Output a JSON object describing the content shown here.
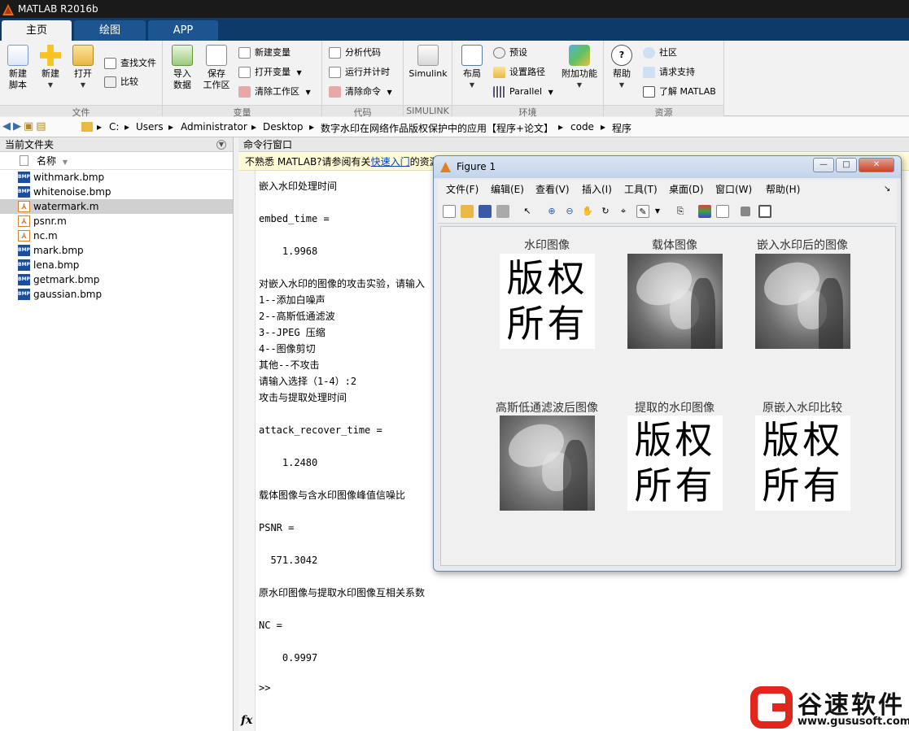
{
  "app": {
    "title": "MATLAB R2016b"
  },
  "tabs": [
    "主页",
    "绘图",
    "APP"
  ],
  "ribbon": {
    "file": {
      "label": "文件",
      "new_script": "新建\n脚本",
      "new": "新建",
      "open": "打开",
      "find_files": "查找文件",
      "compare": "比较"
    },
    "variable": {
      "label": "变量",
      "import": "导入\n数据",
      "save_ws": "保存\n工作区",
      "new_var": "新建变量",
      "open_var": "打开变量",
      "clear_ws": "清除工作区"
    },
    "code": {
      "label": "代码",
      "analyze": "分析代码",
      "run_time": "运行并计时",
      "clear_cmd": "清除命令"
    },
    "simulink": {
      "label": "SIMULINK",
      "simulink": "Simulink"
    },
    "env": {
      "label": "环境",
      "layout": "布局",
      "prefs": "预设",
      "set_path": "设置路径",
      "parallel": "Parallel",
      "addons": "附加功能"
    },
    "resources": {
      "label": "资源",
      "help": "帮助",
      "community": "社区",
      "support": "请求支持",
      "learn": "了解 MATLAB"
    }
  },
  "path": [
    "C:",
    "Users",
    "Administrator",
    "Desktop",
    "数字水印在网络作品版权保护中的应用【程序+论文】",
    "code",
    "程序"
  ],
  "current_folder": {
    "title": "当前文件夹",
    "column": "名称",
    "files": [
      {
        "name": "withmark.bmp",
        "type": "bmp"
      },
      {
        "name": "whitenoise.bmp",
        "type": "bmp"
      },
      {
        "name": "watermark.m",
        "type": "m"
      },
      {
        "name": "psnr.m",
        "type": "m"
      },
      {
        "name": "nc.m",
        "type": "m"
      },
      {
        "name": "mark.bmp",
        "type": "bmp"
      },
      {
        "name": "lena.bmp",
        "type": "bmp"
      },
      {
        "name": "getmark.bmp",
        "type": "bmp"
      },
      {
        "name": "gaussian.bmp",
        "type": "bmp"
      }
    ],
    "selected": "watermark.m"
  },
  "command_window": {
    "title": "命令行窗口",
    "notice_prefix": "不熟悉 MATLAB?请参阅有关",
    "notice_link": "快速入门",
    "notice_suffix": "的资源",
    "output": "嵌入水印处理时间\n\nembed_time =\n\n    1.9968\n\n对嵌入水印的图像的攻击实验，请输入\n1--添加白噪声\n2--高斯低通滤波\n3--JPEG 压缩\n4--图像剪切\n其他--不攻击\n请输入选择（1-4）:2\n攻击与提取处理时间\n\nattack_recover_time =\n\n    1.2480\n\n载体图像与含水印图像峰值信噪比\n\nPSNR =\n\n  571.3042\n\n原水印图像与提取水印图像互相关系数\n\nNC =\n\n    0.9997",
    "prompt": ">>"
  },
  "figure": {
    "title": "Figure 1",
    "menu": [
      "文件(F)",
      "编辑(E)",
      "查看(V)",
      "插入(I)",
      "工具(T)",
      "桌面(D)",
      "窗口(W)",
      "帮助(H)"
    ],
    "subplots": [
      {
        "title": "水印图像",
        "kind": "watermark"
      },
      {
        "title": "载体图像",
        "kind": "photo"
      },
      {
        "title": "嵌入水印后的图像",
        "kind": "noisy"
      },
      {
        "title": "高斯低通滤波后图像",
        "kind": "blur"
      },
      {
        "title": "提取的水印图像",
        "kind": "watermark"
      },
      {
        "title": "原嵌入水印比较",
        "kind": "watermark"
      }
    ],
    "watermark_text": "版权\n所有"
  },
  "brand": {
    "name": "谷速软件",
    "url": "www.gususoft.com",
    "color": "#e1261c"
  }
}
